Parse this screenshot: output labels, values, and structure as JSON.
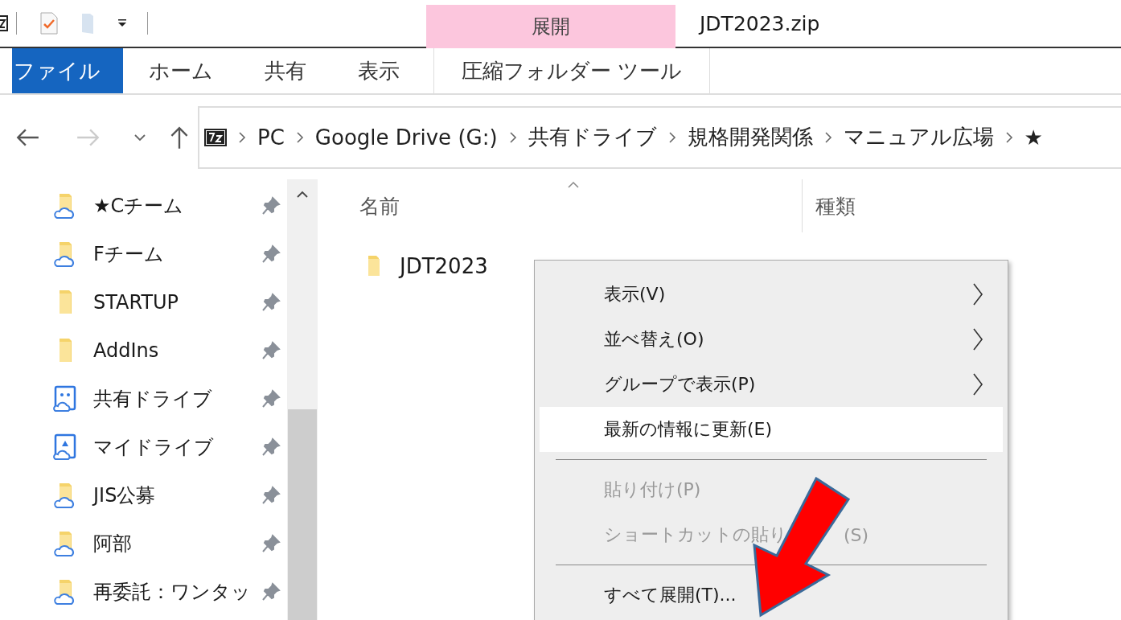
{
  "window": {
    "title": "JDT2023.zip"
  },
  "contextual_tab_group": {
    "label": "展開"
  },
  "ribbon_tabs": [
    {
      "label": "ファイル",
      "kind": "file"
    },
    {
      "label": "ホーム",
      "kind": "tab"
    },
    {
      "label": "共有",
      "kind": "tab"
    },
    {
      "label": "表示",
      "kind": "tab"
    },
    {
      "label": "圧縮フォルダー ツール",
      "kind": "contextual"
    }
  ],
  "navigation": {
    "back_disabled": false,
    "forward_disabled": true
  },
  "address_bar": {
    "crumbs": [
      "PC",
      "Google Drive (G:)",
      "共有ドライブ",
      "規格開発関係",
      "マニュアル広場",
      "★"
    ]
  },
  "sidebar": {
    "items": [
      {
        "label": "★Cチーム",
        "kind": "cloud-folder",
        "pinned": true
      },
      {
        "label": "Fチーム",
        "kind": "cloud-folder",
        "pinned": true
      },
      {
        "label": "STARTUP",
        "kind": "folder",
        "pinned": true
      },
      {
        "label": "AddIns",
        "kind": "folder",
        "pinned": true
      },
      {
        "label": "共有ドライブ",
        "kind": "shared-drive",
        "pinned": true
      },
      {
        "label": "マイドライブ",
        "kind": "my-drive",
        "pinned": true
      },
      {
        "label": "JIS公募",
        "kind": "cloud-folder",
        "pinned": true
      },
      {
        "label": "阿部",
        "kind": "cloud-folder",
        "pinned": true
      },
      {
        "label": "再委託：ワンタッ",
        "kind": "cloud-folder",
        "pinned": true
      }
    ]
  },
  "file_list": {
    "columns": [
      {
        "label": "名前",
        "sorted": true
      },
      {
        "label": "種類",
        "sorted": false
      }
    ],
    "rows": [
      {
        "name": "JDT2023"
      }
    ]
  },
  "context_menu": {
    "items": [
      {
        "kind": "item",
        "label": "表示(V)",
        "submenu": true,
        "disabled": false,
        "highlighted": false
      },
      {
        "kind": "item",
        "label": "並べ替え(O)",
        "submenu": true,
        "disabled": false,
        "highlighted": false
      },
      {
        "kind": "item",
        "label": "グループで表示(P)",
        "submenu": true,
        "disabled": false,
        "highlighted": false
      },
      {
        "kind": "item",
        "label": "最新の情報に更新(E)",
        "submenu": false,
        "disabled": false,
        "highlighted": true
      },
      {
        "kind": "separator"
      },
      {
        "kind": "item",
        "label": "貼り付け(P)",
        "submenu": false,
        "disabled": true,
        "highlighted": false
      },
      {
        "kind": "item",
        "label": "ショートカットの貼り",
        "suffix": "(S)",
        "submenu": false,
        "disabled": true,
        "highlighted": false
      },
      {
        "kind": "separator"
      },
      {
        "kind": "item",
        "label": "すべて展開(T)...",
        "submenu": false,
        "disabled": false,
        "highlighted": false
      }
    ]
  }
}
